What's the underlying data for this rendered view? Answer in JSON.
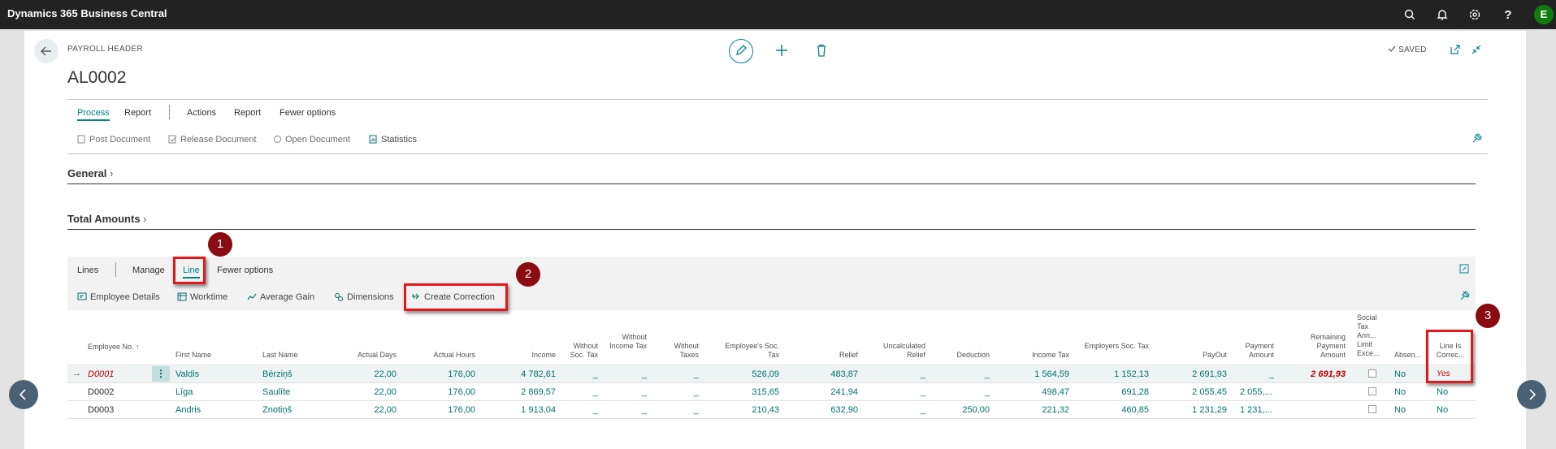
{
  "app_title": "Dynamics 365 Business Central",
  "user_initial": "E",
  "page": {
    "caption": "PAYROLL HEADER",
    "doc_no": "AL0002",
    "status": "SAVED"
  },
  "header_tabs": [
    "Process",
    "Report",
    "Actions",
    "Report",
    "Fewer options"
  ],
  "header_actions": [
    "Post Document",
    "Release Document",
    "Open Document",
    "Statistics"
  ],
  "sections": [
    "General",
    "Total Amounts"
  ],
  "lines_tabs": [
    "Lines",
    "Manage",
    "Line",
    "Fewer options"
  ],
  "lines_actions": [
    "Employee Details",
    "Worktime",
    "Average Gain",
    "Dimensions",
    "Create Correction"
  ],
  "columns": [
    "Employee No. ↑",
    "First Name",
    "Last Name",
    "Actual Days",
    "Actual Hours",
    "Income",
    "Without Soc. Tax",
    "Without Income Tax",
    "Without Taxes",
    "Employee's Soc. Tax",
    "Relief",
    "Uncalculated Relief",
    "Deduction",
    "Income Tax",
    "Employers Soc. Tax",
    "PayOut",
    "Payment Amount",
    "Remaining Payment Amount",
    "Social Tax Ann... Limit Exce...",
    "Absen...",
    "Line Is Correc..."
  ],
  "rows": [
    {
      "emp_no": "D0001",
      "first": "Valdis",
      "last": "Bērziņš",
      "days": "22,00",
      "hours": "176,00",
      "income": "4 782,61",
      "wst": "_",
      "wit": "_",
      "wt": "_",
      "ess": "526,09",
      "relief": "483,87",
      "urel": "_",
      "ded": "_",
      "itax": "1 564,59",
      "ersoc": "1 152,13",
      "payout": "2 691,93",
      "payamt": "_",
      "remain": "2 691,93",
      "absence": "No",
      "corr": "Yes"
    },
    {
      "emp_no": "D0002",
      "first": "Līga",
      "last": "Saulīte",
      "days": "22,00",
      "hours": "176,00",
      "income": "2 869,57",
      "wst": "_",
      "wit": "_",
      "wt": "_",
      "ess": "315,65",
      "relief": "241,94",
      "urel": "_",
      "ded": "_",
      "itax": "498,47",
      "ersoc": "691,28",
      "payout": "2 055,45",
      "payamt": "2 055,...",
      "remain": "",
      "absence": "No",
      "corr": "No"
    },
    {
      "emp_no": "D0003",
      "first": "Andris",
      "last": "Znotiņš",
      "days": "22,00",
      "hours": "176,00",
      "income": "1 913,04",
      "wst": "_",
      "wit": "_",
      "wt": "_",
      "ess": "210,43",
      "relief": "632,90",
      "urel": "_",
      "ded": "250,00",
      "itax": "221,32",
      "ersoc": "460,85",
      "payout": "1 231,29",
      "payamt": "1 231,...",
      "remain": "",
      "absence": "No",
      "corr": "No"
    }
  ],
  "callouts": [
    "1",
    "2",
    "3"
  ],
  "colors": {
    "accent": "#008489",
    "callout": "#e2191c",
    "badge": "#8a0b10",
    "topbar": "#222222"
  },
  "icons": [
    "search-icon",
    "bell-icon",
    "gear-icon",
    "help-icon",
    "back-arrow-icon",
    "pencil-icon",
    "plus-icon",
    "trash-icon",
    "pin-icon"
  ]
}
